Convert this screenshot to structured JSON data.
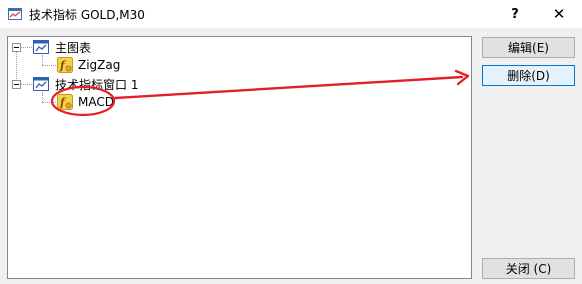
{
  "window": {
    "title": "技术指标 GOLD,M30",
    "help_label": "?",
    "close_label": "✕"
  },
  "tree": {
    "main_chart": {
      "label": "主图表",
      "icon": "chart-window-icon"
    },
    "main_chart_indicators": [
      {
        "label": "ZigZag",
        "icon": "custom-indicator-icon"
      }
    ],
    "indicator_window": {
      "label": "技术指标窗口 1",
      "icon": "chart-window-icon"
    },
    "indicator_window_indicators": [
      {
        "label": "MACD",
        "icon": "custom-indicator-icon"
      }
    ]
  },
  "buttons": {
    "edit": "编辑(E)",
    "delete": "删除(D)",
    "close": "关闭 (C)"
  },
  "annotation": {
    "color": "#e3202a",
    "target": "MACD → 删除(D)"
  }
}
